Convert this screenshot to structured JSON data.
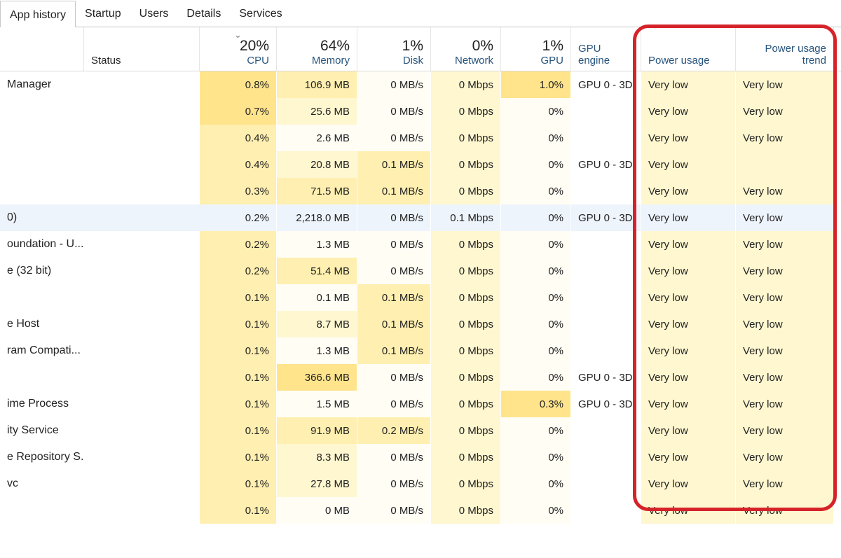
{
  "tabs": [
    "App history",
    "Startup",
    "Users",
    "Details",
    "Services"
  ],
  "headers": {
    "status_label": "Status",
    "cpu": {
      "pct": "20%",
      "label": "CPU"
    },
    "memory": {
      "pct": "64%",
      "label": "Memory"
    },
    "disk": {
      "pct": "1%",
      "label": "Disk"
    },
    "network": {
      "pct": "0%",
      "label": "Network"
    },
    "gpu": {
      "pct": "1%",
      "label": "GPU"
    },
    "gpu_engine_label": "GPU engine",
    "power_label": "Power usage",
    "trend_label": "Power usage trend"
  },
  "rows": [
    {
      "name": "Manager",
      "cpu": "0.8%",
      "mem": "106.9 MB",
      "disk": "0 MB/s",
      "net": "0 Mbps",
      "gpu": "1.0%",
      "gpueng": "GPU 0 - 3D",
      "power": "Very low",
      "trend": "Very low"
    },
    {
      "name": "",
      "cpu": "0.7%",
      "mem": "25.6 MB",
      "disk": "0 MB/s",
      "net": "0 Mbps",
      "gpu": "0%",
      "gpueng": "",
      "power": "Very low",
      "trend": "Very low"
    },
    {
      "name": "",
      "cpu": "0.4%",
      "mem": "2.6 MB",
      "disk": "0 MB/s",
      "net": "0 Mbps",
      "gpu": "0%",
      "gpueng": "",
      "power": "Very low",
      "trend": "Very low"
    },
    {
      "name": "",
      "cpu": "0.4%",
      "mem": "20.8 MB",
      "disk": "0.1 MB/s",
      "net": "0 Mbps",
      "gpu": "0%",
      "gpueng": "GPU 0 - 3D",
      "power": "Very low",
      "trend": ""
    },
    {
      "name": "",
      "cpu": "0.3%",
      "mem": "71.5 MB",
      "disk": "0.1 MB/s",
      "net": "0 Mbps",
      "gpu": "0%",
      "gpueng": "",
      "power": "Very low",
      "trend": "Very low"
    },
    {
      "name": "0)",
      "cpu": "0.2%",
      "mem": "2,218.0 MB",
      "disk": "0 MB/s",
      "net": "0.1 Mbps",
      "gpu": "0%",
      "gpueng": "GPU 0 - 3D",
      "power": "Very low",
      "trend": "Very low",
      "selected": true
    },
    {
      "name": "oundation - U...",
      "cpu": "0.2%",
      "mem": "1.3 MB",
      "disk": "0 MB/s",
      "net": "0 Mbps",
      "gpu": "0%",
      "gpueng": "",
      "power": "Very low",
      "trend": "Very low"
    },
    {
      "name": "e (32 bit)",
      "cpu": "0.2%",
      "mem": "51.4 MB",
      "disk": "0 MB/s",
      "net": "0 Mbps",
      "gpu": "0%",
      "gpueng": "",
      "power": "Very low",
      "trend": "Very low"
    },
    {
      "name": "",
      "cpu": "0.1%",
      "mem": "0.1 MB",
      "disk": "0.1 MB/s",
      "net": "0 Mbps",
      "gpu": "0%",
      "gpueng": "",
      "power": "Very low",
      "trend": "Very low"
    },
    {
      "name": "e Host",
      "cpu": "0.1%",
      "mem": "8.7 MB",
      "disk": "0.1 MB/s",
      "net": "0 Mbps",
      "gpu": "0%",
      "gpueng": "",
      "power": "Very low",
      "trend": "Very low"
    },
    {
      "name": "ram Compati...",
      "cpu": "0.1%",
      "mem": "1.3 MB",
      "disk": "0.1 MB/s",
      "net": "0 Mbps",
      "gpu": "0%",
      "gpueng": "",
      "power": "Very low",
      "trend": "Very low"
    },
    {
      "name": "",
      "cpu": "0.1%",
      "mem": "366.6 MB",
      "disk": "0 MB/s",
      "net": "0 Mbps",
      "gpu": "0%",
      "gpueng": "GPU 0 - 3D",
      "power": "Very low",
      "trend": "Very low"
    },
    {
      "name": "ime Process",
      "cpu": "0.1%",
      "mem": "1.5 MB",
      "disk": "0 MB/s",
      "net": "0 Mbps",
      "gpu": "0.3%",
      "gpueng": "GPU 0 - 3D",
      "power": "Very low",
      "trend": "Very low"
    },
    {
      "name": "ity Service",
      "cpu": "0.1%",
      "mem": "91.9 MB",
      "disk": "0.2 MB/s",
      "net": "0 Mbps",
      "gpu": "0%",
      "gpueng": "",
      "power": "Very low",
      "trend": "Very low"
    },
    {
      "name": "e Repository S...",
      "cpu": "0.1%",
      "mem": "8.3 MB",
      "disk": "0 MB/s",
      "net": "0 Mbps",
      "gpu": "0%",
      "gpueng": "",
      "power": "Very low",
      "trend": "Very low"
    },
    {
      "name": "vc",
      "cpu": "0.1%",
      "mem": "27.8 MB",
      "disk": "0 MB/s",
      "net": "0 Mbps",
      "gpu": "0%",
      "gpueng": "",
      "power": "Very low",
      "trend": "Very low"
    },
    {
      "name": "",
      "cpu": "0.1%",
      "mem": "0 MB",
      "disk": "0 MB/s",
      "net": "0 Mbps",
      "gpu": "0%",
      "gpueng": "",
      "power": "Very low",
      "trend": "Very low"
    }
  ]
}
